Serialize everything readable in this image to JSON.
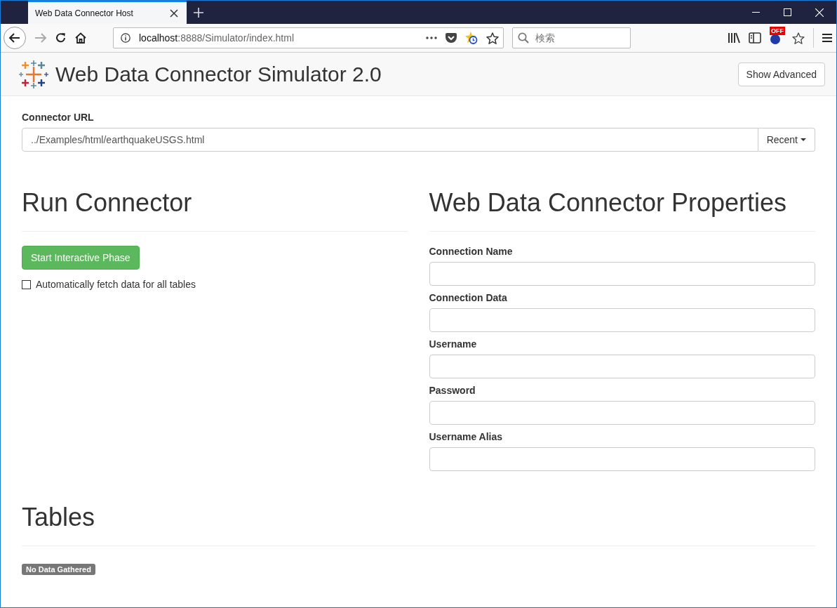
{
  "browser": {
    "tab": {
      "title": "Web Data Connector Host",
      "selected": true
    },
    "address": {
      "host": "localhost",
      "path": ":8888/Simulator/index.html"
    },
    "search": {
      "placeholder": "検索"
    },
    "addon_badge": "OFF"
  },
  "header": {
    "title": "Web Data Connector Simulator 2.0",
    "button": "Show Advanced"
  },
  "connector_url": {
    "label": "Connector URL",
    "value": "../Examples/html/earthquakeUSGS.html",
    "button": "Recent"
  },
  "run_connector": {
    "heading": "Run Connector",
    "button": "Start Interactive Phase",
    "checkbox": {
      "label": "Automatically fetch data for all tables",
      "checked": false
    }
  },
  "properties": {
    "heading": "Web Data Connector Properties",
    "fields": [
      {
        "label": "Connection Name"
      },
      {
        "label": "Connection Data"
      },
      {
        "label": "Username"
      },
      {
        "label": "Password"
      },
      {
        "label": "Username Alias"
      }
    ]
  },
  "tables": {
    "heading": "Tables",
    "status": "No Data Gathered"
  }
}
